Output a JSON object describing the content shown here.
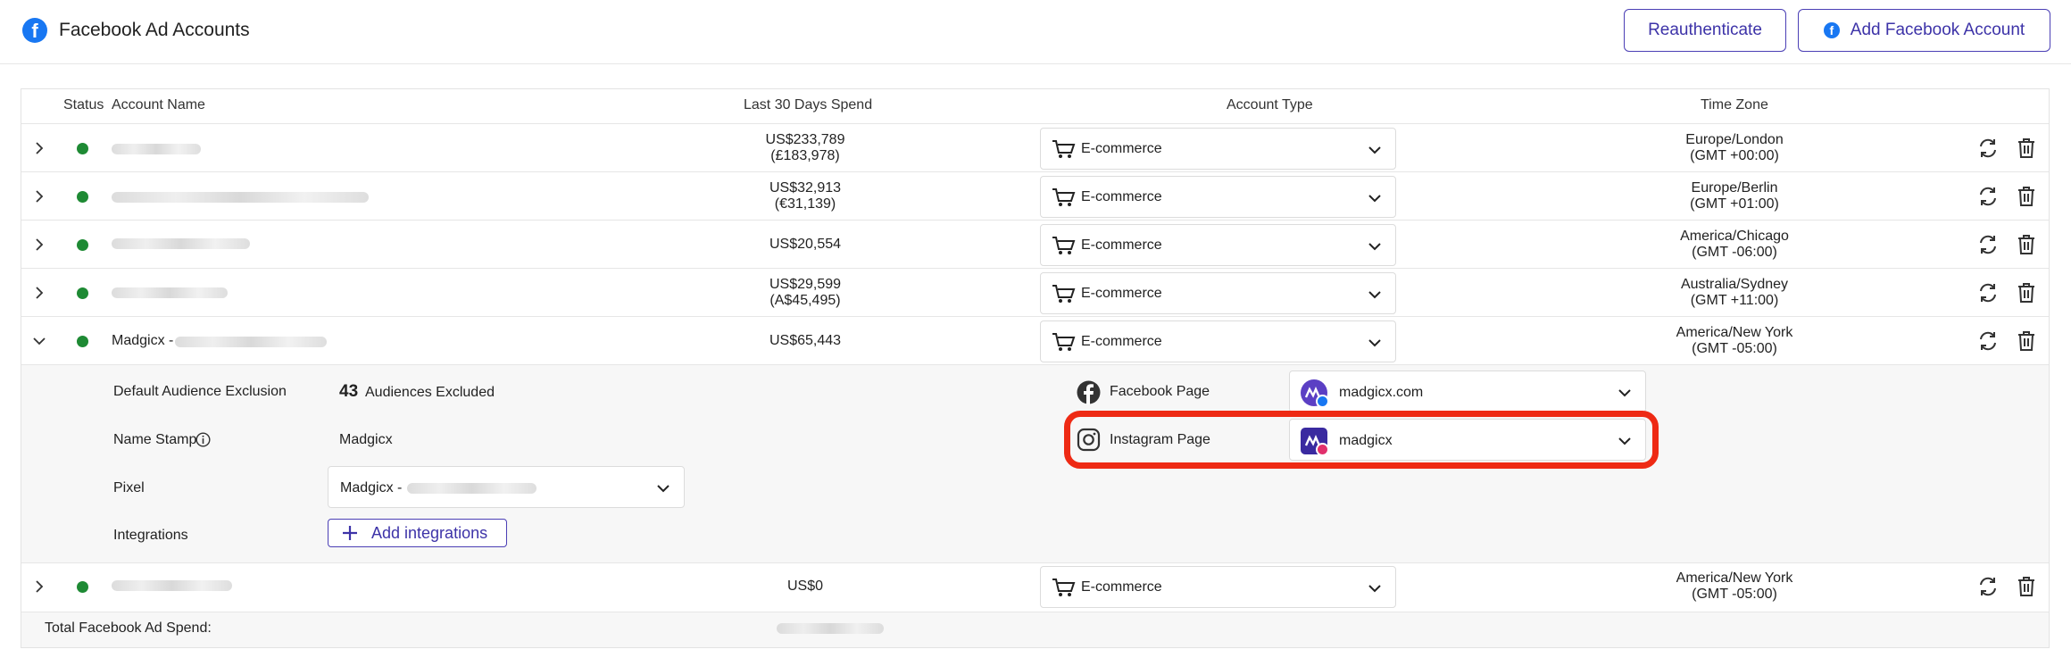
{
  "header": {
    "title": "Facebook Ad Accounts",
    "reauth_label": "Reauthenticate",
    "add_account_label": "Add Facebook Account"
  },
  "table": {
    "columns": [
      "Status",
      "Account Name",
      "Last 30 Days Spend",
      "Account Type",
      "Time Zone"
    ],
    "rows": [
      {
        "spend": "US$233,789",
        "spend_local": "(£183,978)",
        "type": "E-commerce",
        "tz": "Europe/London",
        "tz_offset": "(GMT +00:00)"
      },
      {
        "spend": "US$32,913",
        "spend_local": "(€31,139)",
        "type": "E-commerce",
        "tz": "Europe/Berlin",
        "tz_offset": "(GMT +01:00)"
      },
      {
        "spend": "US$20,554",
        "spend_local": "",
        "type": "E-commerce",
        "tz": "America/Chicago",
        "tz_offset": "(GMT -06:00)"
      },
      {
        "spend": "US$29,599",
        "spend_local": "(A$45,495)",
        "type": "E-commerce",
        "tz": "Australia/Sydney",
        "tz_offset": "(GMT +11:00)"
      },
      {
        "name": "Madgicx -",
        "spend": "US$65,443",
        "spend_local": "",
        "type": "E-commerce",
        "tz": "America/New York",
        "tz_offset": "(GMT -05:00)"
      },
      {
        "spend": "US$0",
        "spend_local": "",
        "type": "E-commerce",
        "tz": "America/New York",
        "tz_offset": "(GMT -05:00)"
      }
    ]
  },
  "details": {
    "audience_label": "Default Audience Exclusion",
    "audience_count": "43",
    "audience_suffix": "Audiences Excluded",
    "name_stamp_label": "Name Stamp",
    "name_stamp_value": "Madgicx",
    "pixel_label": "Pixel",
    "pixel_value": "Madgicx -",
    "integrations_label": "Integrations",
    "add_integrations_label": "Add integrations",
    "facebook_page_label": "Facebook Page",
    "facebook_page_value": "madgicx.com",
    "instagram_page_label": "Instagram Page",
    "instagram_page_value": "madgicx"
  },
  "footer": {
    "total_label": "Total Facebook Ad Spend:"
  },
  "colors": {
    "accent": "#3d33a8",
    "status_active": "#1e8a34",
    "highlight": "#ee2a14",
    "facebook": "#1877f2"
  }
}
